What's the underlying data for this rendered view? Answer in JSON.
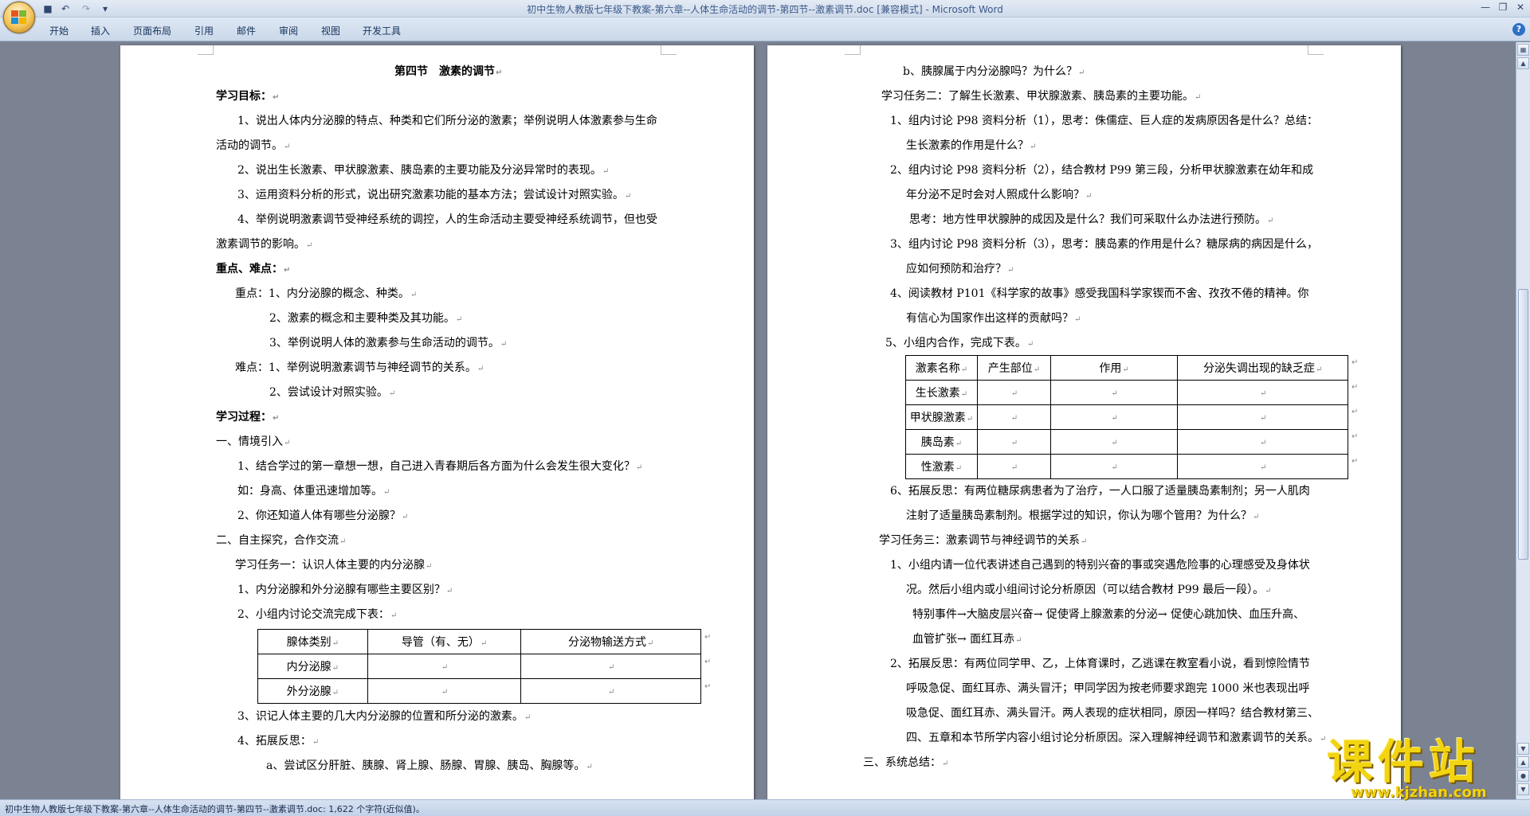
{
  "window": {
    "title": "初中生物人教版七年级下教案-第六章--人体生命活动的调节-第四节--激素调节.doc [兼容模式] - Microsoft Word"
  },
  "qat": {
    "save_icon": "save-icon",
    "undo_icon": "undo-icon",
    "redo_icon": "redo-icon",
    "customize_icon": "customize-icon"
  },
  "ribbon": {
    "tabs": [
      "开始",
      "插入",
      "页面布局",
      "引用",
      "邮件",
      "审阅",
      "视图",
      "开发工具"
    ],
    "help": "?"
  },
  "page1": {
    "title": "第四节　激素的调节",
    "goals_heading": "学习目标：",
    "goal1_a": "1、说出人体内分泌腺的特点、种类和它们所分泌的激素；举例说明人体激素参与生命",
    "goal1_b": "活动的调节。",
    "goal2": "2、说出生长激素、甲状腺激素、胰岛素的主要功能及分泌异常时的表现。",
    "goal3": "3、运用资料分析的形式，说出研究激素功能的基本方法；尝试设计对照实验。",
    "goal4_a": "4、举例说明激素调节受神经系统的调控，人的生命活动主要受神经系统调节，但也受",
    "goal4_b": "激素调节的影响。",
    "key_heading": "重点、难点：",
    "key1": "重点：1、内分泌腺的概念、种类。",
    "key2": "2、激素的概念和主要种类及其功能。",
    "key3": "3、举例说明人体的激素参与生命活动的调节。",
    "diff1": "难点：1、举例说明激素调节与神经调节的关系。",
    "diff2": "2、尝试设计对照实验。",
    "process_heading": "学习过程：",
    "sec1": "一、情境引入",
    "q1": "1、结合学过的第一章想一想，自己进入青春期后各方面为什么会发生很大变化？",
    "q1_ex": "如：身高、体重迅速增加等。",
    "q2": "2、你还知道人体有哪些分泌腺？",
    "sec2": "二、自主探究，合作交流",
    "task1": "学习任务一：认识人体主要的内分泌腺",
    "t1q1": "1、内分泌腺和外分泌腺有哪些主要区别？",
    "t1q2": "2、小组内讨论交流完成下表：",
    "table1": {
      "headers": [
        "腺体类别",
        "导管（有、无）",
        "分泌物输送方式"
      ],
      "rows": [
        [
          "内分泌腺",
          "",
          ""
        ],
        [
          "外分泌腺",
          "",
          ""
        ]
      ]
    },
    "t1q3": "3、识记人体主要的几大内分泌腺的位置和所分泌的激素。",
    "t1q4": "4、拓展反思：",
    "t1q4a": "a、尝试区分肝脏、胰腺、肾上腺、肠腺、胃腺、胰岛、胸腺等。"
  },
  "page2": {
    "b_line": "b、胰腺属于内分泌腺吗？为什么？",
    "task2": "学习任务二：了解生长激素、甲状腺激素、胰岛素的主要功能。",
    "t2q1_a": "1、组内讨论 P98 资料分析（1），思考：侏儒症、巨人症的发病原因各是什么？总结：",
    "t2q1_b": "生长激素的作用是什么？",
    "t2q2_a": "2、组内讨论 P98 资料分析（2），结合教材 P99 第三段，分析甲状腺激素在幼年和成",
    "t2q2_b": "年分泌不足时会对人照成什么影响？",
    "t2q2_c": "思考：地方性甲状腺肿的成因及是什么？我们可采取什么办法进行预防。",
    "t2q3_a": "3、组内讨论 P98 资料分析（3），思考：胰岛素的作用是什么？糖尿病的病因是什么，",
    "t2q3_b": "应如何预防和治疗？",
    "t2q4_a": "4、阅读教材 P101《科学家的故事》感受我国科学家锲而不舍、孜孜不倦的精神。你",
    "t2q4_b": "有信心为国家作出这样的贡献吗？",
    "t2q5": "5、小组内合作，完成下表。",
    "table2": {
      "headers": [
        "激素名称",
        "产生部位",
        "作用",
        "分泌失调出现的缺乏症"
      ],
      "rows": [
        [
          "生长激素",
          "",
          "",
          ""
        ],
        [
          "甲状腺激素",
          "",
          "",
          ""
        ],
        [
          "胰岛素",
          "",
          "",
          ""
        ],
        [
          "性激素",
          "",
          "",
          ""
        ]
      ]
    },
    "t2q6_a": "6、拓展反思：有两位糖尿病患者为了治疗，一人口服了适量胰岛素制剂；另一人肌肉",
    "t2q6_b": "注射了适量胰岛素制剂。根据学过的知识，你认为哪个管用？为什么？",
    "task3": "学习任务三：激素调节与神经调节的关系",
    "t3q1_a": "1、小组内请一位代表讲述自己遇到的特别兴奋的事或突遇危险事的心理感受及身体状",
    "t3q1_b": "况。然后小组内或小组间讨论分析原因（可以结合教材 P99 最后一段）。",
    "t3q1_c": "特别事件→大脑皮层兴奋→ 促使肾上腺激素的分泌→ 促使心跳加快、血压升高、",
    "t3q1_d": "血管扩张→ 面红耳赤",
    "t3q2_a": "2、拓展反思：有两位同学甲、乙，上体育课时，乙逃课在教室看小说，看到惊险情节",
    "t3q2_b": "呼吸急促、面红耳赤、满头冒汗；甲同学因为按老师要求跑完 1000 米也表现出呼",
    "t3q2_c": "吸急促、面红耳赤、满头冒汗。两人表现的症状相同，原因一样吗？结合教材第三、",
    "t3q2_d": "四、五章和本节所学内容小组讨论分析原因。深入理解神经调节和激素调节的关系。",
    "sec3": "三、系统总结："
  },
  "para_mark": "↵",
  "status": {
    "text": "初中生物人教版七年级下教案-第六章--人体生命活动的调节-第四节--激素调节.doc: 1,622 个字符(近似值)。"
  },
  "watermark": {
    "main": "课件站",
    "url": "www.kjzhan.com"
  }
}
